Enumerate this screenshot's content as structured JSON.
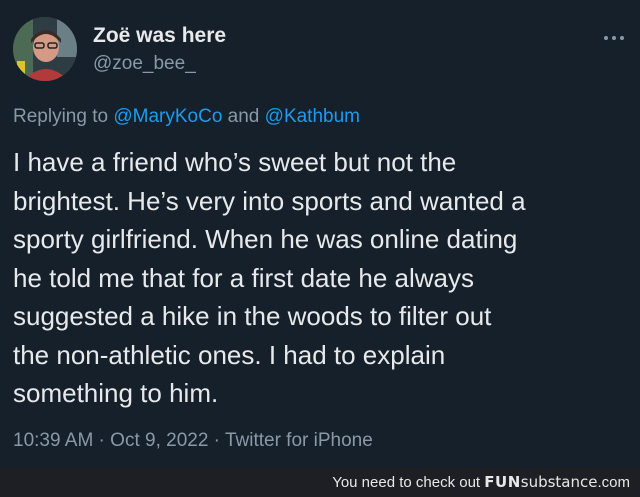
{
  "author": {
    "display_name": "Zoë was here",
    "handle": "@zoe_bee_"
  },
  "reply": {
    "prefix": "Replying to ",
    "mention_1": "@MaryKoCo",
    "connector": " and ",
    "mention_2": "@Kathbum"
  },
  "tweet": {
    "lines": [
      "I have a friend who’s sweet but not the",
      "brightest. He’s very into sports and wanted a",
      "sporty girlfriend. When he was online dating",
      "he told me that for a first date he always",
      "suggested a hike in the woods to filter out",
      "the non-athletic ones. I had to explain",
      "something to him."
    ]
  },
  "meta": {
    "time": "10:39 AM",
    "separator": " · ",
    "date": "Oct 9, 2022",
    "source": "Twitter for iPhone"
  },
  "footer": {
    "prefix": "You need to check out ",
    "brand_bold": "FUN",
    "brand_rest": "substance",
    "suffix": ".com"
  },
  "icons": {
    "more": "more-options-icon",
    "avatar": "profile-avatar"
  },
  "colors": {
    "background": "#15202b",
    "accent": "#1d9bf0",
    "text_primary": "#e7e9ea",
    "text_secondary": "#8b98a5",
    "footer_background": "#1d1f24"
  }
}
